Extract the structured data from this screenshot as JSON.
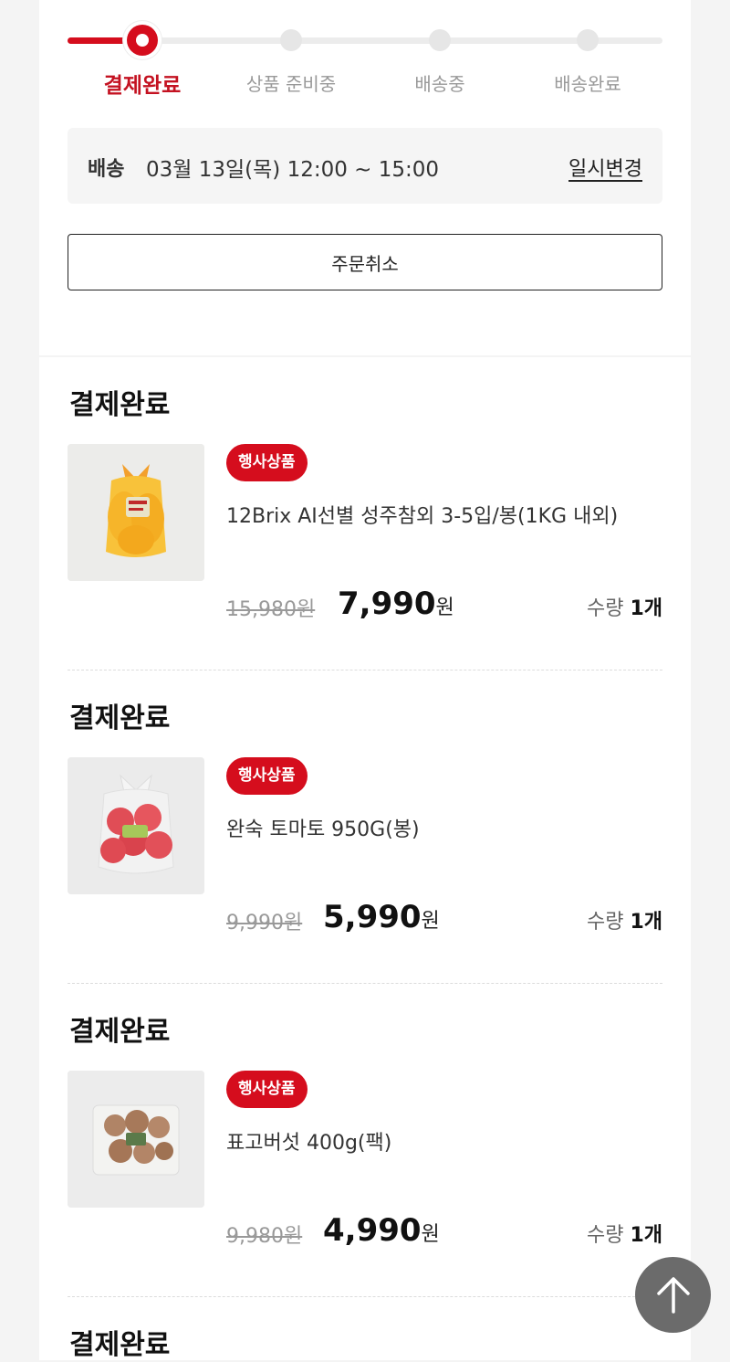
{
  "progress": {
    "steps": [
      "결제완료",
      "상품 준비중",
      "배송중",
      "배송완료"
    ],
    "active_index": 0
  },
  "delivery": {
    "label": "배송",
    "time": "03월 13일(목) 12:00 ~ 15:00",
    "change_label": "일시변경"
  },
  "cancel_label": "주문취소",
  "items": [
    {
      "status": "결제완료",
      "badge": "행사상품",
      "name": "12Brix AI선별 성주참외 3-5입/봉(1KG 내외)",
      "original_price": "15,980원",
      "sale_price": "7,990",
      "currency": "원",
      "qty_label": "수량",
      "qty": "1개"
    },
    {
      "status": "결제완료",
      "badge": "행사상품",
      "name": "완숙 토마토 950G(봉)",
      "original_price": "9,990원",
      "sale_price": "5,990",
      "currency": "원",
      "qty_label": "수량",
      "qty": "1개"
    },
    {
      "status": "결제완료",
      "badge": "행사상품",
      "name": "표고버섯 400g(팩)",
      "original_price": "9,980원",
      "sale_price": "4,990",
      "currency": "원",
      "qty_label": "수량",
      "qty": "1개"
    },
    {
      "status": "결제완료"
    }
  ],
  "colors": {
    "accent": "#d50d1d",
    "active_step_text": "#c41221",
    "scroll_top_bg": "#6b6b6b"
  },
  "icons": {
    "scroll_top": "arrow-up-icon"
  }
}
